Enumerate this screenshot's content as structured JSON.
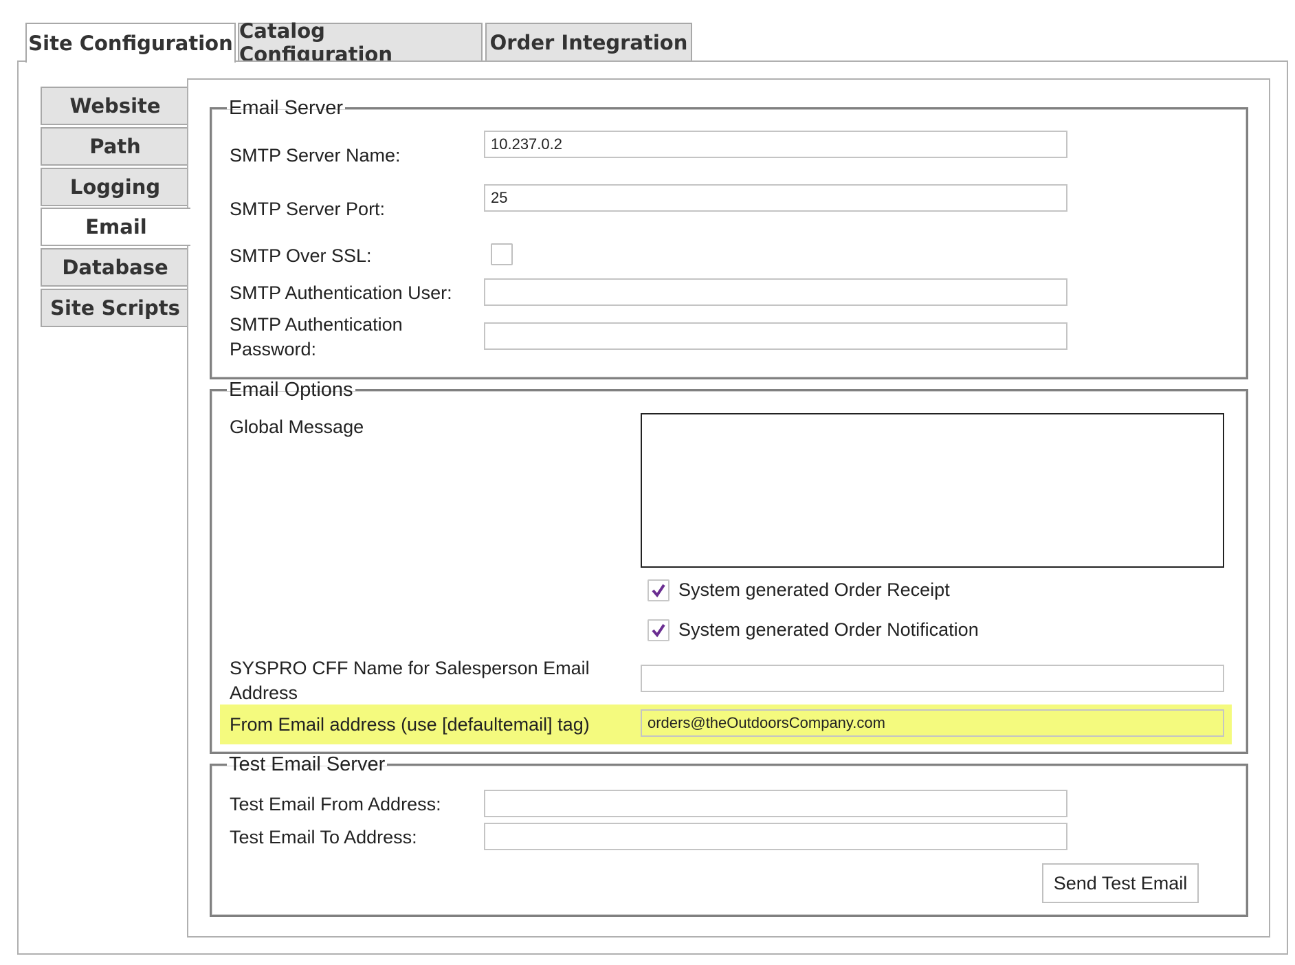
{
  "top_tabs": [
    {
      "label": "Site Configuration",
      "active": true
    },
    {
      "label": "Catalog Configuration",
      "active": false
    },
    {
      "label": "Order Integration",
      "active": false
    }
  ],
  "side_tabs": [
    {
      "label": "Website",
      "active": false
    },
    {
      "label": "Path",
      "active": false
    },
    {
      "label": "Logging",
      "active": false
    },
    {
      "label": "Email",
      "active": true
    },
    {
      "label": "Database",
      "active": false
    },
    {
      "label": "Site Scripts",
      "active": false
    }
  ],
  "email_server": {
    "legend": "Email Server",
    "smtp_server_name_label": "SMTP Server Name:",
    "smtp_server_name_value": "10.237.0.2",
    "smtp_server_port_label": "SMTP Server Port:",
    "smtp_server_port_value": "25",
    "smtp_over_ssl_label": "SMTP Over SSL:",
    "smtp_over_ssl_checked": false,
    "smtp_auth_user_label": "SMTP Authentication User:",
    "smtp_auth_user_value": "",
    "smtp_auth_password_label_line1": "SMTP Authentication",
    "smtp_auth_password_label_line2": "Password:",
    "smtp_auth_password_value": ""
  },
  "email_options": {
    "legend": "Email Options",
    "global_message_label": "Global Message",
    "global_message_value": "",
    "order_receipt_label": "System generated Order Receipt",
    "order_receipt_checked": true,
    "order_notification_label": "System generated Order Notification",
    "order_notification_checked": true,
    "cff_label_line1": "SYSPRO CFF Name for Salesperson Email",
    "cff_label_line2": "Address",
    "cff_value": "",
    "from_email_label": "From Email address (use [defaultemail] tag)",
    "from_email_value": "orders@theOutdoorsCompany.com"
  },
  "test_email_server": {
    "legend": "Test Email Server",
    "from_label": "Test Email From Address:",
    "from_value": "",
    "to_label": "Test Email To Address:",
    "to_value": "",
    "send_button_label": "Send Test Email"
  },
  "colors": {
    "highlight": "#f4fa7e",
    "checkmark": "#6a2d91",
    "tab_inactive": "#e3e3e3"
  },
  "icons": {
    "checkbox_checked": "check-icon"
  }
}
